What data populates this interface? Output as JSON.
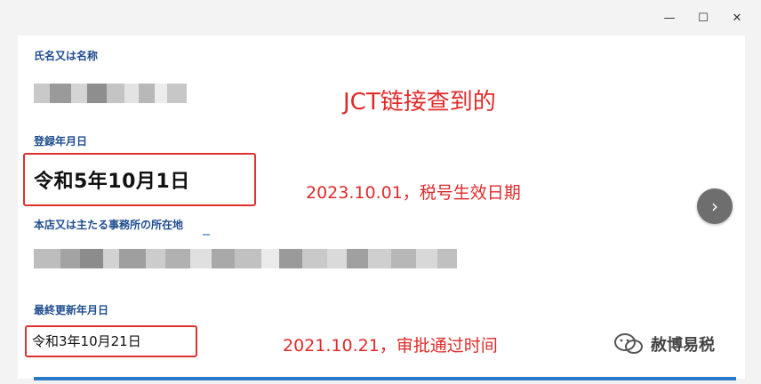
{
  "window": {
    "minimize_icon": "minimize-icon",
    "maximize_icon": "maximize-icon",
    "close_icon": "close-icon",
    "minimize_glyph": "—",
    "maximize_glyph": "☐",
    "close_glyph": "✕"
  },
  "fields": {
    "name_label": "氏名又は名称",
    "registration_date_label": "登録年月日",
    "registration_date_value": "令和5年10月1日",
    "address_label": "本店又は主たる事務所の所在地",
    "last_update_label": "最終更新年月日",
    "last_update_value": "令和3年10月21日"
  },
  "annotations": {
    "jct_note": "JCT链接查到的",
    "registration_note": "2023.10.01，税号生效日期",
    "update_note": "2021.10.21，审批通过时间"
  },
  "next_button": {
    "icon": "chevron-right-icon",
    "glyph": "›"
  },
  "watermark": {
    "icon": "wechat-icon",
    "text": "赦博易税"
  },
  "colors": {
    "label_blue": "#1f4d8f",
    "annotation_red": "#e02a2a",
    "box_red": "#e03030"
  }
}
